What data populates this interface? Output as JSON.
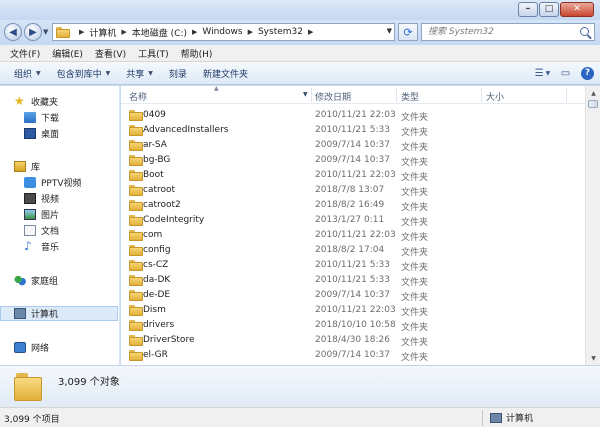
{
  "window": {
    "minimize_glyph": "–",
    "maximize_glyph": "□",
    "close_glyph": "✕"
  },
  "address": {
    "crumbs": [
      "计算机",
      "本地磁盘 (C:)",
      "Windows",
      "System32"
    ],
    "search_placeholder": "搜索 System32"
  },
  "menu": [
    "文件(F)",
    "编辑(E)",
    "查看(V)",
    "工具(T)",
    "帮助(H)"
  ],
  "toolbar": [
    "组织",
    "包含到库中",
    "共享",
    "刻录",
    "新建文件夹"
  ],
  "nav": {
    "favorites": "收藏夹",
    "downloads": "下载",
    "desktop": "桌面",
    "libraries": "库",
    "pptv": "PPTV视频",
    "videos": "视频",
    "pictures": "图片",
    "documents": "文档",
    "music": "音乐",
    "homegroup": "家庭组",
    "computer": "计算机",
    "network": "网络"
  },
  "columns": {
    "name": "名称",
    "date": "修改日期",
    "type": "类型",
    "size": "大小"
  },
  "files": [
    {
      "name": "0409",
      "date": "2010/11/21 22:03",
      "type": "文件夹"
    },
    {
      "name": "AdvancedInstallers",
      "date": "2010/11/21 5:33",
      "type": "文件夹"
    },
    {
      "name": "ar-SA",
      "date": "2009/7/14 10:37",
      "type": "文件夹"
    },
    {
      "name": "bg-BG",
      "date": "2009/7/14 10:37",
      "type": "文件夹"
    },
    {
      "name": "Boot",
      "date": "2010/11/21 22:03",
      "type": "文件夹"
    },
    {
      "name": "catroot",
      "date": "2018/7/8 13:07",
      "type": "文件夹"
    },
    {
      "name": "catroot2",
      "date": "2018/8/2 16:49",
      "type": "文件夹"
    },
    {
      "name": "CodeIntegrity",
      "date": "2013/1/27 0:11",
      "type": "文件夹"
    },
    {
      "name": "com",
      "date": "2010/11/21 22:03",
      "type": "文件夹"
    },
    {
      "name": "config",
      "date": "2018/8/2 17:04",
      "type": "文件夹"
    },
    {
      "name": "cs-CZ",
      "date": "2010/11/21 5:33",
      "type": "文件夹"
    },
    {
      "name": "da-DK",
      "date": "2010/11/21 5:33",
      "type": "文件夹"
    },
    {
      "name": "de-DE",
      "date": "2009/7/14 10:37",
      "type": "文件夹"
    },
    {
      "name": "Dism",
      "date": "2010/11/21 22:03",
      "type": "文件夹"
    },
    {
      "name": "drivers",
      "date": "2018/10/10 10:58",
      "type": "文件夹"
    },
    {
      "name": "DriverStore",
      "date": "2018/4/30 18:26",
      "type": "文件夹"
    },
    {
      "name": "el-GR",
      "date": "2009/7/14 10:37",
      "type": "文件夹"
    }
  ],
  "details": {
    "count": "3,099 个对象"
  },
  "status": {
    "items": "3,099 个项目",
    "location": "计算机"
  }
}
